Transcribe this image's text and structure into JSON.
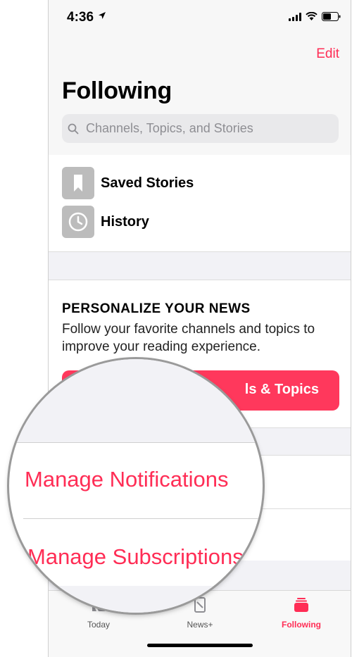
{
  "status_bar": {
    "time": "4:36"
  },
  "header": {
    "edit_label": "Edit",
    "title": "Following"
  },
  "search": {
    "placeholder": "Channels, Topics, and Stories"
  },
  "library": [
    {
      "label": "Saved Stories",
      "icon": "bookmark-icon"
    },
    {
      "label": "History",
      "icon": "clock-icon"
    }
  ],
  "personalize": {
    "heading": "PERSONALIZE YOUR NEWS",
    "text": "Follow your favorite channels and topics to improve your reading experience.",
    "button_label": "ls & Topics"
  },
  "magnified": {
    "item1": "Manage Notifications",
    "item2": "Manage Subscriptions"
  },
  "tabs": [
    {
      "label": "Today",
      "icon": "news-icon",
      "active": false
    },
    {
      "label": "News+",
      "icon": "newsplus-icon",
      "active": false
    },
    {
      "label": "Following",
      "icon": "following-icon",
      "active": true
    }
  ],
  "colors": {
    "accent": "#ff2d55",
    "inactive_tab": "#8e8e93",
    "tile_gray": "#bcbcbc"
  }
}
